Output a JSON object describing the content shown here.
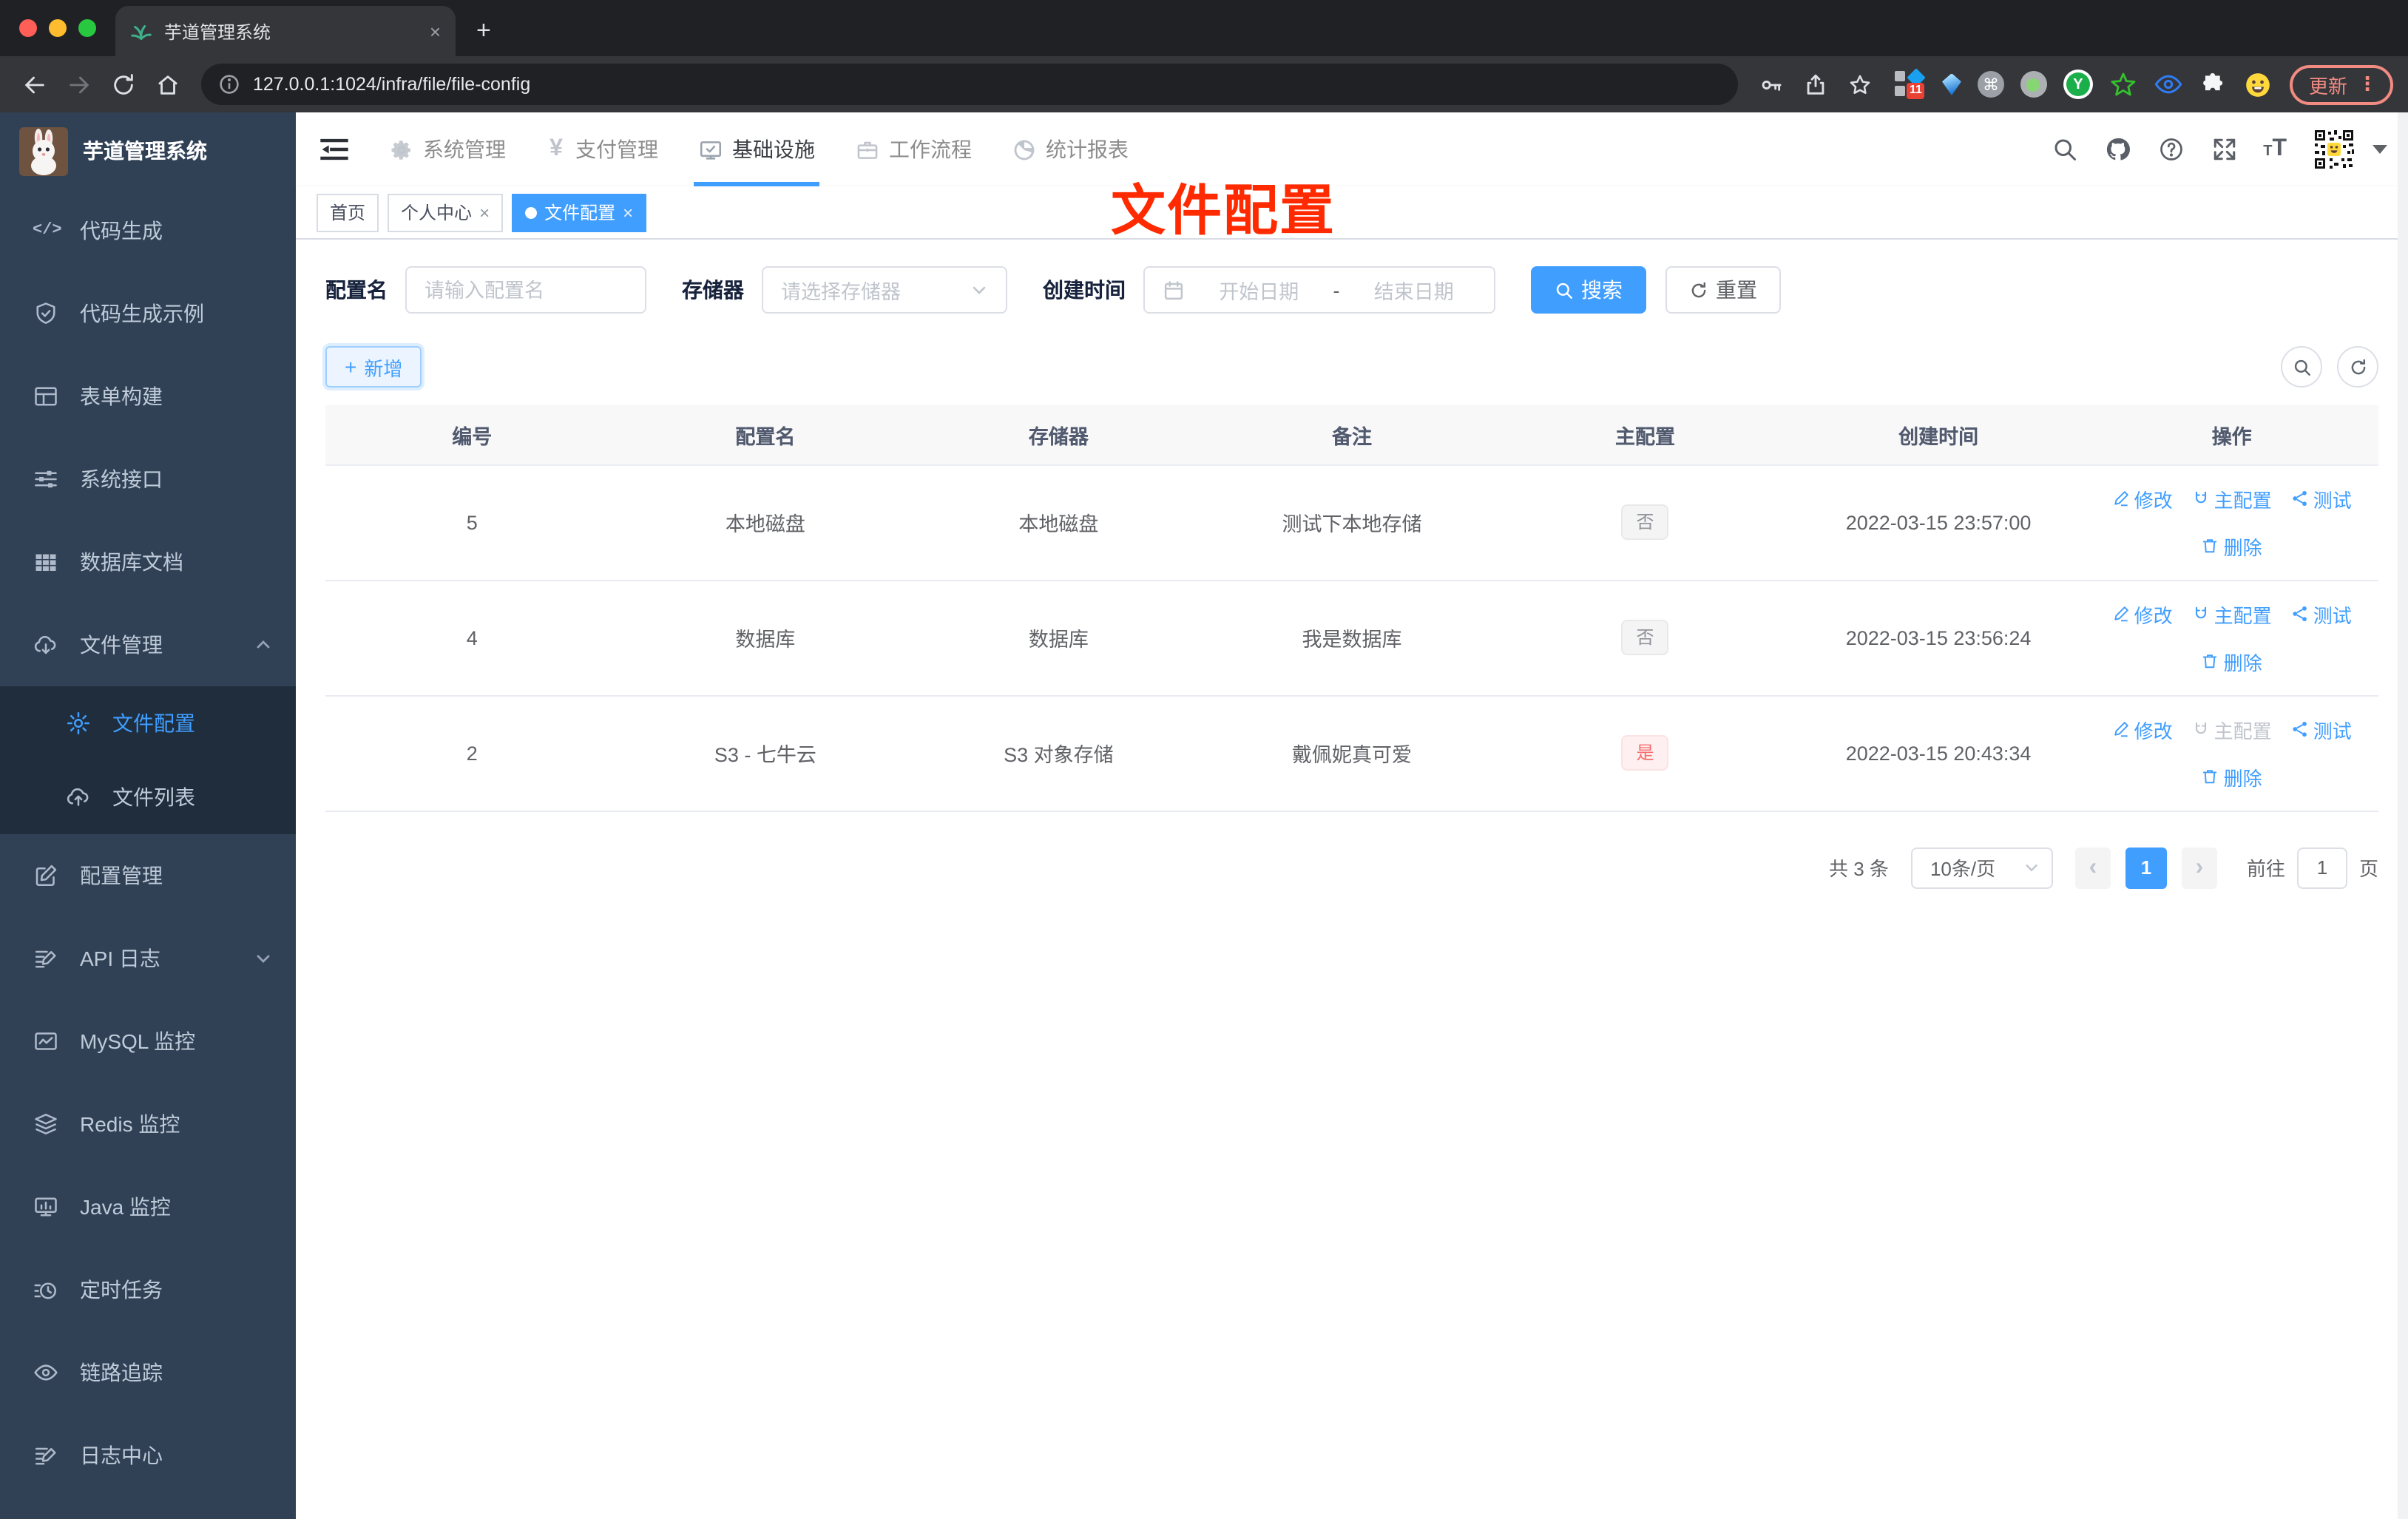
{
  "colors": {
    "accent": "#409eff",
    "sidebar_bg": "#304156",
    "submenu_bg": "#1f2d3d",
    "tag_info_text": "#909399",
    "tag_danger_text": "#f56c6c",
    "annotation_red": "#ff2a00",
    "update_pill": "#f28b82",
    "traffic_red": "#ff5f57",
    "traffic_yellow": "#febc2e",
    "traffic_green": "#28c840"
  },
  "browser": {
    "tab_title": "芋道管理系统",
    "url": "127.0.0.1:1024/infra/file/file-config",
    "update_label": "更新",
    "extension_badge": "11",
    "icons": [
      "back-icon",
      "forward-icon",
      "reload-icon",
      "home-icon",
      "site-info-icon",
      "key-icon",
      "share-icon",
      "star-icon",
      "extensions",
      "kebab-menu-icon"
    ]
  },
  "annotation": {
    "text": "文件配置"
  },
  "sidebar": {
    "logo_title": "芋道管理系统",
    "items": [
      {
        "icon": "code-icon",
        "label": "代码生成"
      },
      {
        "icon": "shield-check-icon",
        "label": "代码生成示例"
      },
      {
        "icon": "form-grid-icon",
        "label": "表单构建"
      },
      {
        "icon": "sliders-icon",
        "label": "系统接口"
      },
      {
        "icon": "table-filled-icon",
        "label": "数据库文档"
      },
      {
        "icon": "cloud-download-icon",
        "label": "文件管理",
        "expanded": true,
        "children": [
          {
            "icon": "gear-icon",
            "label": "文件配置",
            "active": true
          },
          {
            "icon": "cloud-upload-icon",
            "label": "文件列表"
          }
        ]
      },
      {
        "icon": "edit-square-icon",
        "label": "配置管理"
      },
      {
        "icon": "document-edit-icon",
        "label": "API 日志",
        "collapsed": true
      },
      {
        "icon": "chart-line-icon",
        "label": "MySQL 监控"
      },
      {
        "icon": "layers-icon",
        "label": "Redis 监控"
      },
      {
        "icon": "monitor-icon",
        "label": "Java 监控"
      },
      {
        "icon": "timer-icon",
        "label": "定时任务"
      },
      {
        "icon": "eye-icon",
        "label": "链路追踪"
      },
      {
        "icon": "document-edit-icon",
        "label": "日志中心"
      }
    ]
  },
  "topnav": {
    "items": [
      {
        "icon": "gear-icon",
        "label": "系统管理"
      },
      {
        "icon": "yen-icon",
        "label": "支付管理"
      },
      {
        "icon": "monitor-check-icon",
        "label": "基础设施",
        "active": true
      },
      {
        "icon": "briefcase-icon",
        "label": "工作流程"
      },
      {
        "icon": "dashboard-icon",
        "label": "统计报表"
      }
    ],
    "right_icons": [
      "search-icon",
      "github-icon",
      "help-icon",
      "fullscreen-icon",
      "font-size-icon",
      "avatar-qr",
      "caret-down-icon"
    ]
  },
  "tagsview": {
    "tabs": [
      {
        "label": "首页",
        "closable": false,
        "active": false
      },
      {
        "label": "个人中心",
        "closable": true,
        "active": false
      },
      {
        "label": "文件配置",
        "closable": true,
        "active": true
      }
    ]
  },
  "filters": {
    "config_name_label": "配置名",
    "config_name_placeholder": "请输入配置名",
    "storage_label": "存储器",
    "storage_placeholder": "请选择存储器",
    "create_time_label": "创建时间",
    "date_start_placeholder": "开始日期",
    "date_separator": "-",
    "date_end_placeholder": "结束日期",
    "search_label": "搜索",
    "reset_label": "重置"
  },
  "toolbar": {
    "add_label": "新增"
  },
  "table": {
    "columns": [
      "编号",
      "配置名",
      "存储器",
      "备注",
      "主配置",
      "创建时间",
      "操作"
    ],
    "actions": {
      "edit": "修改",
      "master": "主配置",
      "test": "测试",
      "delete": "删除"
    },
    "rows": [
      {
        "id": "5",
        "name": "本地磁盘",
        "storage": "本地磁盘",
        "remark": "测试下本地存储",
        "master": "否",
        "master_type": "info",
        "created": "2022-03-15 23:57:00",
        "master_action_disabled": false
      },
      {
        "id": "4",
        "name": "数据库",
        "storage": "数据库",
        "remark": "我是数据库",
        "master": "否",
        "master_type": "info",
        "created": "2022-03-15 23:56:24",
        "master_action_disabled": false
      },
      {
        "id": "2",
        "name": "S3 - 七牛云",
        "storage": "S3 对象存储",
        "remark": "戴佩妮真可爱",
        "master": "是",
        "master_type": "danger",
        "created": "2022-03-15 20:43:34",
        "master_action_disabled": true
      }
    ]
  },
  "pagination": {
    "total_text": "共 3 条",
    "page_size": "10条/页",
    "current_page": "1",
    "goto_label": "前往",
    "goto_value": "1",
    "page_label": "页"
  }
}
